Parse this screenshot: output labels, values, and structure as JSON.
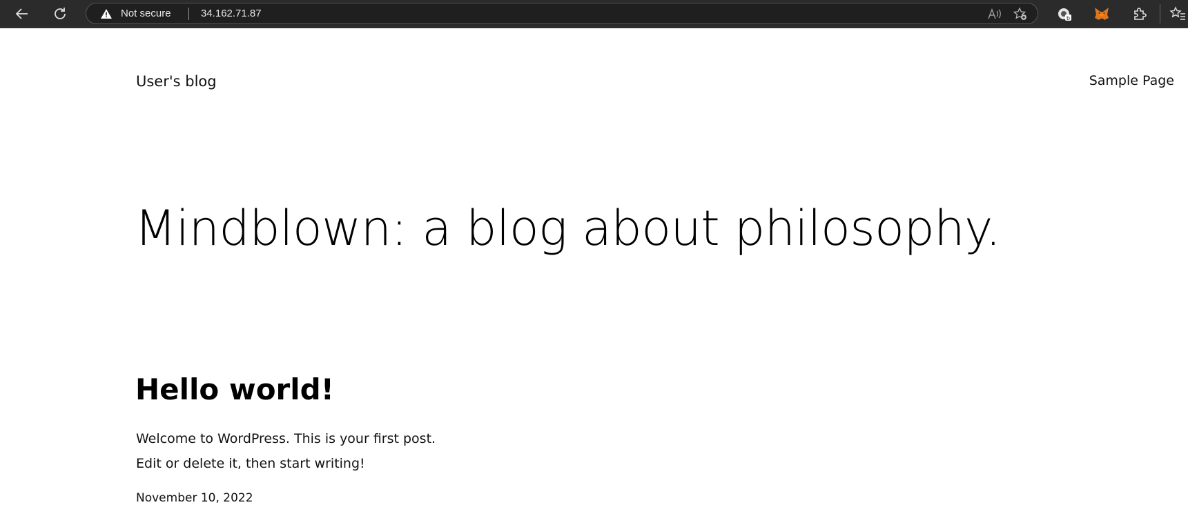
{
  "browser": {
    "security_label": "Not secure",
    "url": "34.162.71.87",
    "icons": {
      "back": "back-arrow-icon",
      "reload": "reload-icon",
      "warning": "warning-icon",
      "read_aloud": "read-aloud-icon",
      "add_favorite": "add-favorite-icon",
      "extension_1": "browser-extension-icon",
      "metamask": "metamask-fox-icon",
      "extensions": "puzzle-icon",
      "favorites": "favorites-icon"
    }
  },
  "site": {
    "title": "User's blog",
    "nav": [
      {
        "label": "Sample Page"
      }
    ]
  },
  "hero": {
    "heading": "Mindblown: a blog about philosophy."
  },
  "post": {
    "title": "Hello world!",
    "excerpt_lines": [
      "Welcome to WordPress. This is your first post.",
      "Edit or delete it, then start writing!"
    ],
    "date": "November 10, 2022"
  },
  "colors": {
    "chrome_bg": "#2b2b2b",
    "omnibox_bg": "#1f1f1f",
    "page_bg": "#ffffff",
    "text": "#000000"
  }
}
